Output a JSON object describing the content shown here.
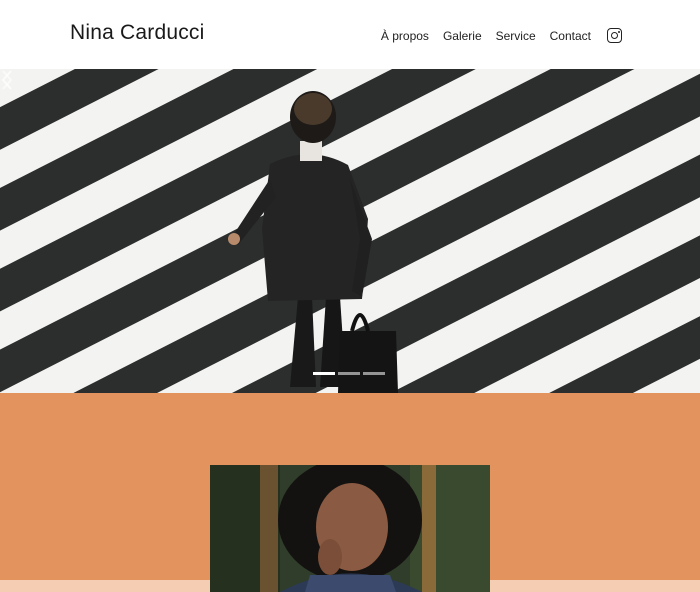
{
  "header": {
    "brand": "Nina Carducci",
    "nav": [
      "À propos",
      "Galerie",
      "Service",
      "Contact"
    ],
    "instagram_icon": "instagram-icon"
  },
  "hero": {
    "image_alt": "Homme en costume traversant un passage piéton",
    "prev_icon": "chevron-left-icon",
    "next_icon": "chevron-right-icon",
    "slide_count": 3,
    "active_slide": 1
  },
  "about": {
    "background_color": "#e3935e",
    "strip_color": "#f4cdb3",
    "portrait_alt": "Portrait de Nina Carducci"
  }
}
